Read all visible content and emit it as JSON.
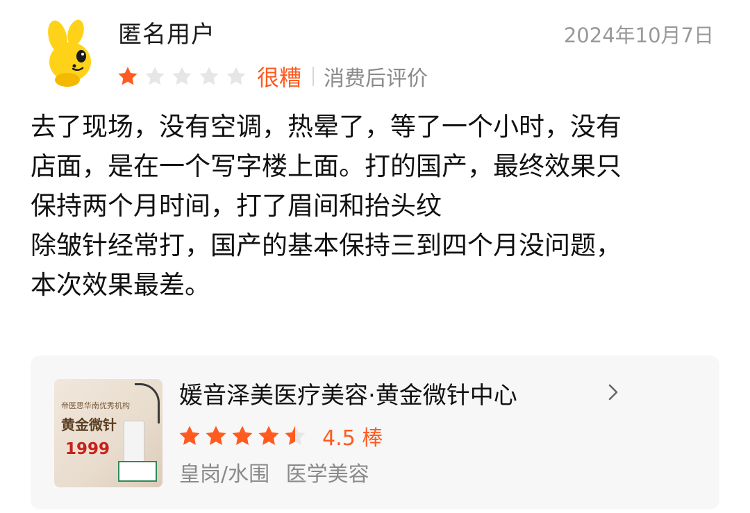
{
  "review": {
    "username": "匿名用户",
    "date": "2024年10月7日",
    "rating": 1,
    "rating_max": 5,
    "rating_word": "很糟",
    "tag": "消费后评价",
    "text_lines": [
      "去了现场，没有空调，热晕了，等了一个小时，没有",
      "店面，是在一个写字楼上面。打的国产，最终效果只",
      "保持两个月时间，打了眉间和抬头纹",
      "除皱针经常打，国产的基本保持三到四个月没问题，",
      "本次效果最差。"
    ]
  },
  "shop": {
    "name": "媛音泽美医疗美容·黄金微针中心",
    "rating": 4.5,
    "rating_max": 5,
    "score_label": "4.5 棒",
    "area": "皇岗/水围",
    "category": "医学美容",
    "thumbnail": {
      "line1": "帝医思华南优秀机构",
      "line2": "黄金微针",
      "line3": "1999"
    }
  },
  "colors": {
    "accent": "#ff5a1f",
    "star_empty": "#e6e6e6",
    "muted": "#8a8a8a",
    "card_bg": "#f7f7f7"
  },
  "icons": {
    "avatar": "yellow-cartoon-avatar-icon",
    "star": "star-icon",
    "chevron": "chevron-right-icon"
  }
}
